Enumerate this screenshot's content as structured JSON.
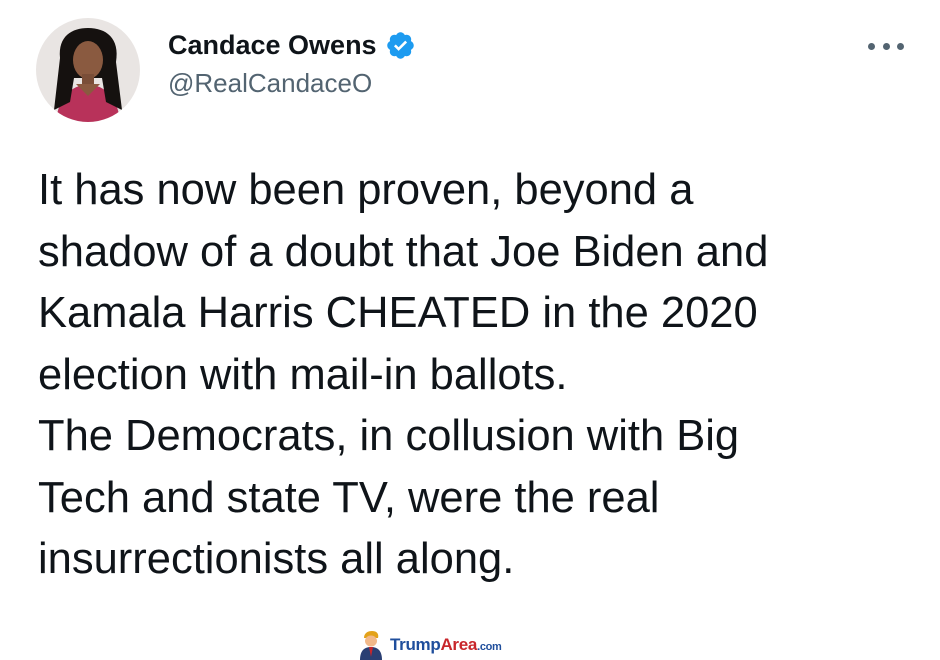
{
  "tweet": {
    "display_name": "Candace Owens",
    "handle": "@RealCandaceO",
    "verified_icon": "verified-badge-icon",
    "more_icon": "more-options-icon",
    "text": "It has now been proven, beyond a\nshadow of a doubt that Joe Biden and\nKamala Harris CHEATED in the 2020\nelection with mail-in ballots.\nThe Democrats, in collusion with Big\nTech and state TV, were the real\ninsurrectionists all along."
  },
  "watermark": {
    "trump": "Trump",
    "area": "Area",
    "com": ".com"
  },
  "colors": {
    "verified": "#1d9bf0",
    "name": "#0f1419",
    "handle": "#536471",
    "watermark_blue": "#1f4e9c",
    "watermark_red": "#c8262b"
  }
}
